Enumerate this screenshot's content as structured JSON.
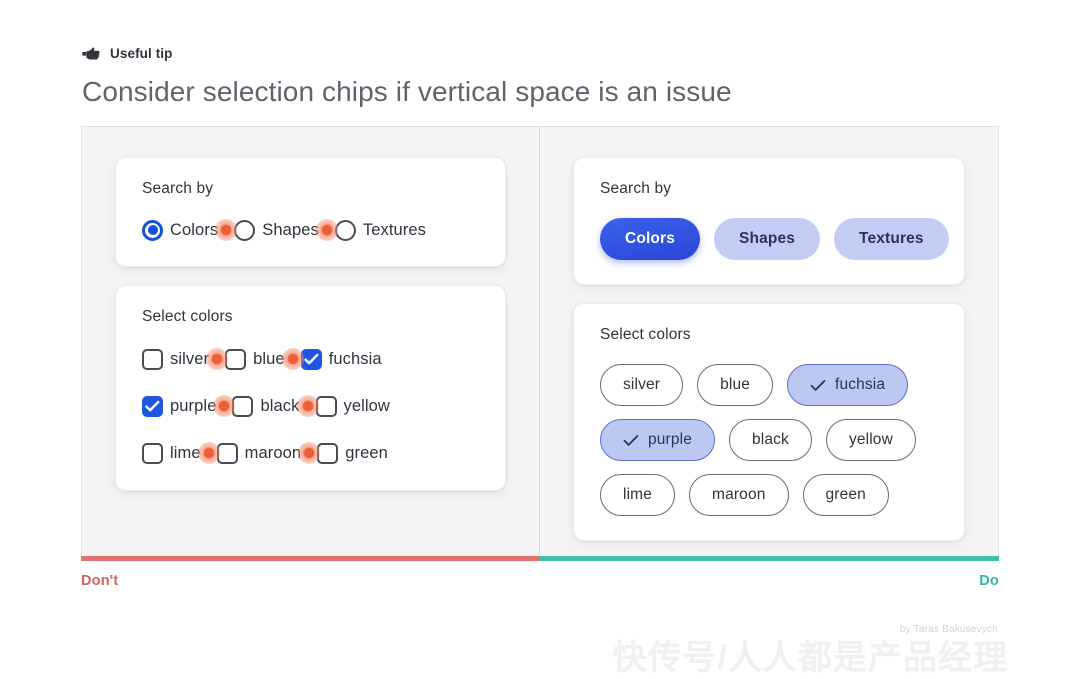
{
  "header": {
    "tip_icon": "pointing-hand-icon",
    "tip_label": "Useful tip",
    "headline": "Consider selection chips if vertical space is an issue"
  },
  "dont_pane": {
    "search_card": {
      "title": "Search by",
      "options": [
        {
          "label": "Colors",
          "selected": true
        },
        {
          "label": "Shapes",
          "selected": false
        },
        {
          "label": "Textures",
          "selected": false
        }
      ]
    },
    "colors_card": {
      "title": "Select colors",
      "rows": [
        [
          {
            "label": "silver",
            "checked": false
          },
          {
            "label": "blue",
            "checked": false
          },
          {
            "label": "fuchsia",
            "checked": true
          }
        ],
        [
          {
            "label": "purple",
            "checked": true
          },
          {
            "label": "black",
            "checked": false
          },
          {
            "label": "yellow",
            "checked": false
          }
        ],
        [
          {
            "label": "lime",
            "checked": false
          },
          {
            "label": "maroon",
            "checked": false
          },
          {
            "label": "green",
            "checked": false
          }
        ]
      ]
    }
  },
  "do_pane": {
    "search_card": {
      "title": "Search by",
      "chips": [
        {
          "label": "Colors",
          "selected": true
        },
        {
          "label": "Shapes",
          "selected": false
        },
        {
          "label": "Textures",
          "selected": false
        }
      ]
    },
    "colors_card": {
      "title": "Select colors",
      "rows": [
        [
          {
            "label": "silver",
            "selected": false
          },
          {
            "label": "blue",
            "selected": false
          },
          {
            "label": "fuchsia",
            "selected": true
          }
        ],
        [
          {
            "label": "purple",
            "selected": true
          },
          {
            "label": "black",
            "selected": false
          },
          {
            "label": "yellow",
            "selected": false
          }
        ],
        [
          {
            "label": "lime",
            "selected": false
          },
          {
            "label": "maroon",
            "selected": false
          },
          {
            "label": "green",
            "selected": false
          }
        ]
      ]
    }
  },
  "verdicts": {
    "dont": "Don't",
    "do": "Do"
  },
  "footer": {
    "credit": "by Taras Bakusevych",
    "watermark": "快传号/人人都是产品经理"
  },
  "colors": {
    "accent_blue": "#1f55e0",
    "chip_selected_fill": "#bdc8f2",
    "chip_tab_selected": "#2a46d8",
    "chip_tab_unselected": "#c3cdf4",
    "hotspot": "#ec5f36",
    "dont_bar": "#e3726e",
    "do_bar": "#3fc0a8"
  }
}
